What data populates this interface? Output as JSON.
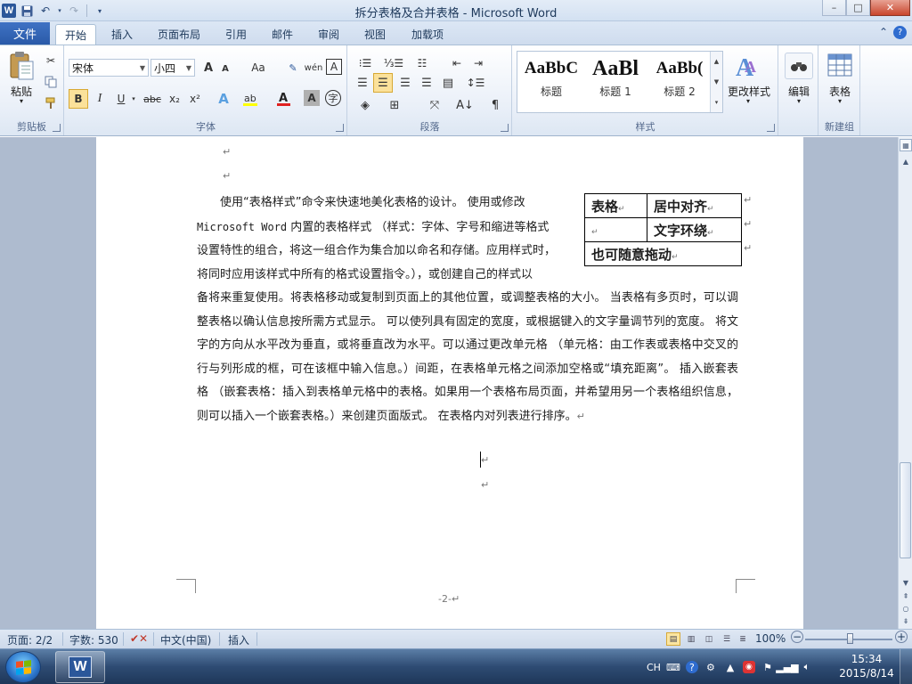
{
  "window": {
    "title": "拆分表格及合并表格 - Microsoft Word",
    "app_icon": "W",
    "controls": {
      "minimize": "–",
      "maximize": "□",
      "close": "✕"
    }
  },
  "qat": {
    "icons": [
      "save-icon",
      "undo-icon",
      "redo-icon",
      "customize-icon"
    ]
  },
  "tabs": {
    "file": "文件",
    "items": [
      "开始",
      "插入",
      "页面布局",
      "引用",
      "邮件",
      "审阅",
      "视图",
      "加载项"
    ],
    "active": "开始"
  },
  "ribbon": {
    "clipboard": {
      "paste": "粘贴",
      "label": "剪贴板"
    },
    "font": {
      "font_name": "宋体",
      "font_size": "小四",
      "grow": "A",
      "shrink": "A",
      "change_case": "Aa",
      "bold": "B",
      "italic": "I",
      "underline": "U",
      "strike": "abc",
      "subscript": "x₂",
      "superscript": "x²",
      "label": "字体"
    },
    "paragraph": {
      "label": "段落"
    },
    "styles": {
      "items": [
        {
          "sample": "AaBbC",
          "name": "标题"
        },
        {
          "sample": "AaBl",
          "name": "标题 1"
        },
        {
          "sample": "AaBb(",
          "name": "标题 2"
        }
      ],
      "change_styles": "更改样式",
      "label": "样式"
    },
    "editing": {
      "label": "编辑"
    },
    "table": {
      "label": "表格",
      "group": "新建组"
    }
  },
  "document": {
    "body": {
      "line1": "使用“表格样式”命令来快速地美化表格的设计。 使用或修改",
      "line2a": "Microsoft Word",
      "line2b": " 内置的表格样式 （样式：字体、字号和缩进等格式",
      "line3": "设置特性的组合，将这一组合作为集合加以命名和存储。应用样式时，",
      "line4": "将同时应用该样式中所有的格式设置指令。），或创建自己的样式以",
      "rest": "备将来重复使用。将表格移动或复制到页面上的其他位置，或调整表格的大小。 当表格有多页时，可以调整表格以确认信息按所需方式显示。 可以使列具有固定的宽度，或根据键入的文字量调节列的宽度。  将文字的方向从水平改为垂直，或将垂直改为水平。可以通过更改单元格 （单元格：由工作表或表格中交叉的行与列形成的框，可在该框中输入信息。）间距，在表格单元格之间添加空格或“填充距离”。 插入嵌套表格 （嵌套表格：插入到表格单元格中的表格。如果用一个表格布局页面，并希望用另一个表格组织信息，则可以插入一个嵌套表格。）来创建页面版式。 在表格内对列表进行排序。"
    },
    "table": {
      "r1c1": "表格",
      "r1c2": "居中对齐",
      "r2c2": "文字环绕",
      "r3": "也可随意拖动"
    },
    "para_mark": "↵",
    "page_number": "-2-"
  },
  "status": {
    "page": "页面: 2/2",
    "words": "字数: 530",
    "language": "中文(中国)",
    "mode": "插入",
    "zoom": "100%",
    "zoom_minus": "−",
    "zoom_plus": "+"
  },
  "taskbar": {
    "lang": "CH",
    "time": "15:34",
    "date": "2015/8/14"
  }
}
